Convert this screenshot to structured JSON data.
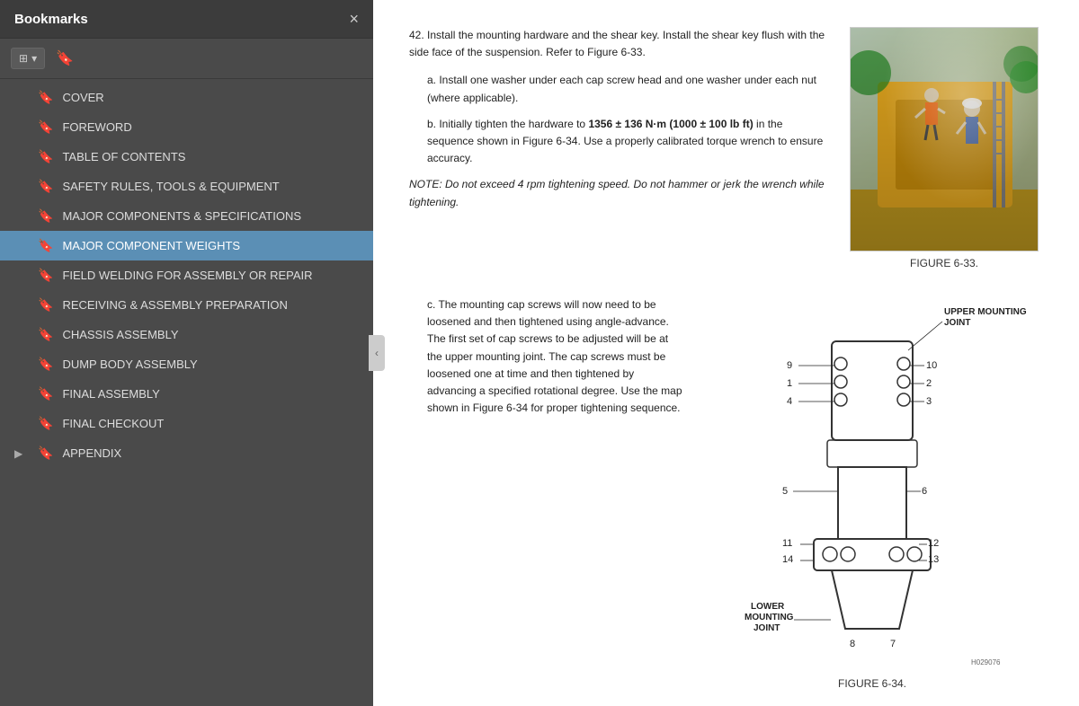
{
  "sidebar": {
    "title": "Bookmarks",
    "close_label": "×",
    "toolbar": {
      "view_btn": "≡▾",
      "bookmark_btn": "🔖"
    },
    "items": [
      {
        "id": "cover",
        "label": "COVER",
        "active": false,
        "expandable": false
      },
      {
        "id": "foreword",
        "label": "FOREWORD",
        "active": false,
        "expandable": false
      },
      {
        "id": "toc",
        "label": "TABLE OF CONTENTS",
        "active": false,
        "expandable": false
      },
      {
        "id": "safety",
        "label": "SAFETY RULES, TOOLS & EQUIPMENT",
        "active": false,
        "expandable": false
      },
      {
        "id": "major-components",
        "label": "MAJOR COMPONENTS & SPECIFICATIONS",
        "active": false,
        "expandable": false
      },
      {
        "id": "major-weights",
        "label": "MAJOR COMPONENT WEIGHTS",
        "active": true,
        "expandable": false
      },
      {
        "id": "field-welding",
        "label": "FIELD WELDING FOR ASSEMBLY OR REPAIR",
        "active": false,
        "expandable": false
      },
      {
        "id": "receiving",
        "label": "RECEIVING & ASSEMBLY PREPARATION",
        "active": false,
        "expandable": false
      },
      {
        "id": "chassis",
        "label": "CHASSIS ASSEMBLY",
        "active": false,
        "expandable": false
      },
      {
        "id": "dump-body",
        "label": "DUMP BODY ASSEMBLY",
        "active": false,
        "expandable": false
      },
      {
        "id": "final-assembly",
        "label": "FINAL ASSEMBLY",
        "active": false,
        "expandable": false
      },
      {
        "id": "final-checkout",
        "label": "FINAL CHECKOUT",
        "active": false,
        "expandable": false
      },
      {
        "id": "appendix",
        "label": "APPENDIX",
        "active": false,
        "expandable": true
      }
    ]
  },
  "content": {
    "paragraphs": [
      {
        "num": "42.",
        "text": "Install the mounting hardware and the shear key. Install the shear key flush with the side face of the suspension. Refer to Figure 6-33."
      }
    ],
    "sub_items": [
      {
        "letter": "a.",
        "text": "Install one washer under each cap screw head and one washer under each nut (where applicable)."
      },
      {
        "letter": "b.",
        "text_before": "Initially tighten the hardware to ",
        "bold": "1356 ± 136 N·m (1000 ± 100 lb ft)",
        "text_after": " in the sequence shown in Figure 6-34. Use a properly calibrated torque wrench to ensure accuracy."
      }
    ],
    "note": "NOTE: Do not exceed 4 rpm tightening speed. Do not hammer or jerk the wrench while tightening.",
    "figure_33_label": "FIGURE 6-33.",
    "para_c": {
      "letter": "c.",
      "text": "The mounting cap screws will now need to be loosened and then tightened using angle-advance. The first set of cap screws to be adjusted will be at the upper mounting joint. The cap screws must be loosened one at time and then tightened by advancing a specified rotational degree. Use the map shown in Figure 6-34 for proper tightening sequence."
    },
    "figure_34_label": "FIGURE 6-34.",
    "diagram": {
      "upper_label": "UPPER MOUNTING",
      "upper_label2": "JOINT",
      "lower_label": "LOWER",
      "lower_label2": "MOUNTING",
      "lower_label3": "JOINT",
      "numbers_right": [
        "10",
        "2",
        "3",
        "6",
        "12",
        "13",
        "7"
      ],
      "numbers_left": [
        "9",
        "1",
        "4",
        "5",
        "11",
        "14",
        "8"
      ]
    }
  }
}
